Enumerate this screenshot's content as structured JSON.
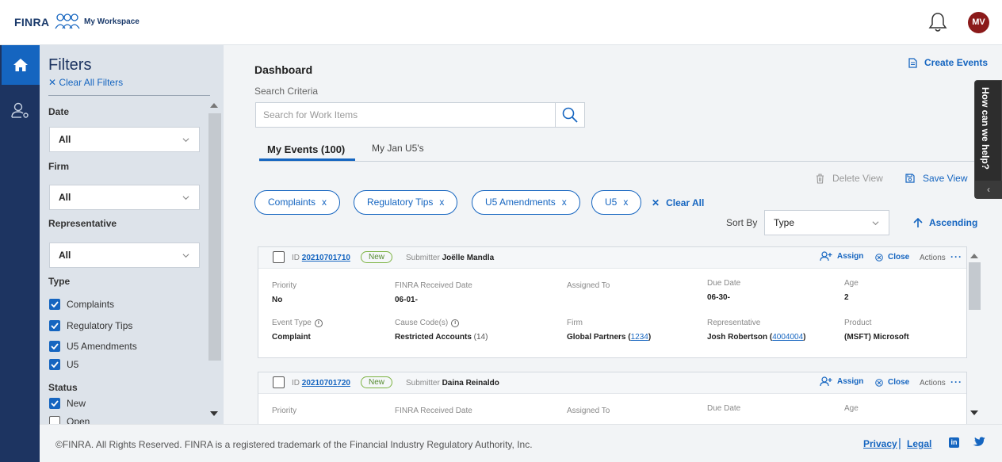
{
  "header": {
    "logo": "FINRA",
    "workspace_label": "My Workspace",
    "avatar_initials": "MV"
  },
  "filters": {
    "title": "Filters",
    "clear_all": "Clear All Filters",
    "date": {
      "label": "Date",
      "value": "All"
    },
    "firm": {
      "label": "Firm",
      "value": "All"
    },
    "representative": {
      "label": "Representative",
      "value": "All"
    },
    "type": {
      "label": "Type",
      "options": [
        {
          "label": "Complaints",
          "checked": true
        },
        {
          "label": "Regulatory Tips",
          "checked": true
        },
        {
          "label": "U5 Amendments",
          "checked": true
        },
        {
          "label": "U5",
          "checked": true
        }
      ]
    },
    "status": {
      "label": "Status",
      "options": [
        {
          "label": "New",
          "checked": true
        },
        {
          "label": "Open",
          "checked": false
        }
      ]
    }
  },
  "main": {
    "title": "Dashboard",
    "create_events": "Create Events",
    "search_label": "Search Criteria",
    "search_placeholder": "Search for Work Items",
    "tabs": [
      {
        "label": "My Events (100)",
        "active": true
      },
      {
        "label": "My Jan U5's",
        "active": false
      }
    ],
    "help_tab": "How can we help?",
    "delete_view": "Delete View",
    "save_view": "Save View",
    "chips": [
      "Complaints",
      "Regulatory Tips",
      "U5 Amendments",
      "U5"
    ],
    "chip_remove": "x",
    "clear_all": "Clear All",
    "sort_label": "Sort By",
    "sort_value": "Type",
    "sort_order": "Ascending"
  },
  "cards": [
    {
      "id_label": "ID",
      "id": "20210701710",
      "status": "New",
      "submitter_label": "Submitter",
      "submitter": "Joëlle Mandla",
      "assign": "Assign",
      "close": "Close",
      "actions": "Actions",
      "priority_label": "Priority",
      "priority": "No",
      "received_label": "FINRA Received Date",
      "received": "06-01-",
      "assigned_label": "Assigned To",
      "assigned": "",
      "due_label": "Due Date",
      "due": "06-30-",
      "age_label": "Age",
      "age": "2",
      "event_type_label": "Event Type",
      "event_type": "Complaint",
      "cause_label": "Cause Code(s)",
      "cause": "Restricted Accounts",
      "cause_count": "(14)",
      "firm_label": "Firm",
      "firm": "Global Partners",
      "firm_id": "1234",
      "rep_label": "Representative",
      "rep": "Josh Robertson",
      "rep_id": "4004004",
      "product_label": "Product",
      "product": "(MSFT) Microsoft"
    },
    {
      "id_label": "ID",
      "id": "20210701720",
      "status": "New",
      "submitter_label": "Submitter",
      "submitter": "Daina Reinaldo",
      "assign": "Assign",
      "close": "Close",
      "actions": "Actions",
      "priority_label": "Priority",
      "received_label": "FINRA Received Date",
      "assigned_label": "Assigned To",
      "due_label": "Due Date",
      "age_label": "Age"
    }
  ],
  "footer": {
    "copyright": "©FINRA. All Rights Reserved. FINRA is a registered trademark of the Financial Industry Regulatory Authority, Inc.",
    "privacy": "Privacy",
    "separator": "|",
    "legal": "Legal",
    "linkedin": "in"
  },
  "colors": {
    "brand_navy": "#1d3461",
    "accent_blue": "#1565c0",
    "avatar_red": "#8b1a1a",
    "status_green": "#558b2f"
  }
}
